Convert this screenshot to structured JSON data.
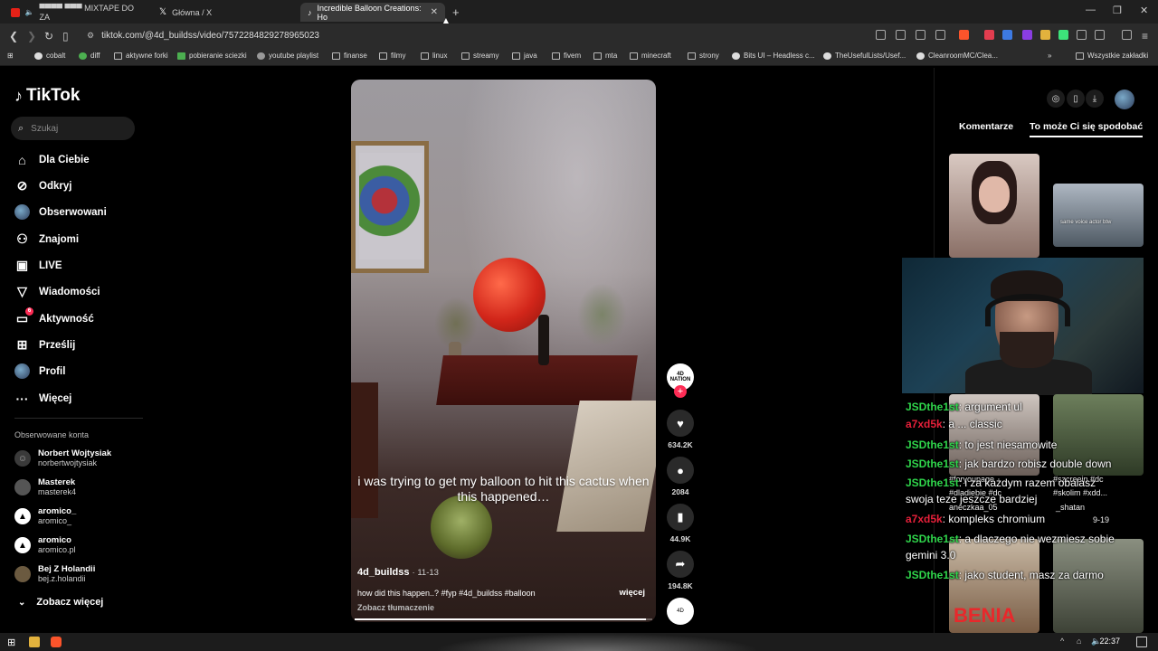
{
  "browser": {
    "tabs": [
      {
        "title": "▀▀▀▀ ▀▀▀ MIXTAPE DO ZA",
        "active": false
      },
      {
        "title": "Główna / X",
        "active": false
      },
      {
        "title": "Incredible Balloon Creations: Ho",
        "active": true
      }
    ],
    "new_tab_icon": "plus-icon",
    "url": "tiktok.com/@4d_buildss/video/7572284829278965023",
    "bookmarks": [
      "cobalt",
      "diff",
      "aktywne forki",
      "pobieranie sciezki",
      "youtube playlist",
      "finanse",
      "filmy",
      "linux",
      "streamy",
      "java",
      "fivem",
      "mta",
      "minecraft",
      "strony",
      "Bits UI – Headless c...",
      "TheUsefulLists/Usef...",
      "CleanroomMC/Clea...",
      "Wszystkie zakładki"
    ]
  },
  "tiktok": {
    "logo": "TikTok",
    "search_placeholder": "Szukaj",
    "nav": [
      {
        "label": "Dla Ciebie",
        "icon": "home-icon"
      },
      {
        "label": "Odkryj",
        "icon": "compass-icon"
      },
      {
        "label": "Obserwowani",
        "icon": "following-avatar-icon"
      },
      {
        "label": "Znajomi",
        "icon": "friends-icon"
      },
      {
        "label": "LIVE",
        "icon": "live-tv-icon"
      },
      {
        "label": "Wiadomości",
        "icon": "messages-icon"
      },
      {
        "label": "Aktywność",
        "icon": "activity-icon",
        "badge": "6"
      },
      {
        "label": "Prześlij",
        "icon": "upload-plus-icon"
      },
      {
        "label": "Profil",
        "icon": "profile-avatar-icon"
      },
      {
        "label": "Więcej",
        "icon": "more-dots-icon"
      }
    ],
    "following_title": "Obserwowane konta",
    "following_accounts": [
      {
        "name": "Norbert Wojtysiak",
        "handle": "norbertwojtysiak"
      },
      {
        "name": "Masterek",
        "handle": "masterek4"
      },
      {
        "name": "aromico_",
        "handle": "aromico_"
      },
      {
        "name": "aromico",
        "handle": "aromico.pl"
      },
      {
        "name": "Bej Z Holandii",
        "handle": "bej.z.holandii"
      }
    ],
    "see_more": "Zobacz więcej"
  },
  "video": {
    "caption_overlay": "i was trying to get my balloon to hit this cactus when this happened…",
    "author": "4d_buildss",
    "date": "· 11-13",
    "description": "how did this happen..? #fyp #4d_buildss #balloon",
    "more_label": "więcej",
    "translate_label": "Zobacz tłumaczenie",
    "creator_avatar_text": "4D NATION",
    "progress": 0.98,
    "actions": [
      {
        "name": "like",
        "icon": "heart-icon",
        "count": "634.2K"
      },
      {
        "name": "comment",
        "icon": "comment-icon",
        "count": "2084"
      },
      {
        "name": "save",
        "icon": "bookmark-icon",
        "count": "44.9K"
      },
      {
        "name": "share",
        "icon": "share-icon",
        "count": "194.8K"
      }
    ]
  },
  "right_panel": {
    "tabs": [
      "Komentarze",
      "To może Ci się spodobać"
    ],
    "active_tab": 1,
    "thumb_overlay_1": "same voice actor btw",
    "thumb_overlay_2": "#foryoupage",
    "thumb_overlay_3": "#dladiebie #dc",
    "thumb_overlay_4": "#szcreein #dc",
    "thumb_overlay_5": "#skolim #xdd...",
    "thumb_overlay_6": "_shatan",
    "thumb_overlay_7": "aneczkaa_05",
    "thumb_overlay_8": "9-19",
    "thumb_overlay_9": "BENIA"
  },
  "stream_chat": [
    {
      "user": "JSDthe1st",
      "color": "#2fd54b",
      "text": "argument ul"
    },
    {
      "user": "a7xd5k",
      "color": "#e6203a",
      "text": "a ... classic"
    },
    {
      "user": "JSDthe1st",
      "color": "#2fd54b",
      "text": "to jest niesamowite"
    },
    {
      "user": "JSDthe1st",
      "color": "#2fd54b",
      "text": "jak bardzo robisz double down"
    },
    {
      "user": "JSDthe1st",
      "color": "#2fd54b",
      "text": "i za każdym razem obalasz"
    },
    {
      "user": "",
      "color": "#ffffff",
      "text": "swoja teze jeszcze bardziej"
    },
    {
      "user": "a7xd5k",
      "color": "#e6203a",
      "text": "kompleks chromium"
    },
    {
      "user": "JSDthe1st",
      "color": "#2fd54b",
      "text": "a dlaczego nie wezmiesz sobie"
    },
    {
      "user": "",
      "color": "#ffffff",
      "text": "gemini 3.0"
    },
    {
      "user": "JSDthe1st",
      "color": "#2fd54b",
      "text": "jako student, masz za darmo"
    }
  ],
  "taskbar": {
    "time": "22:37"
  },
  "colors": {
    "accent": "#fe2c55",
    "chat_green": "#2fd54b",
    "chat_red": "#e6203a"
  }
}
